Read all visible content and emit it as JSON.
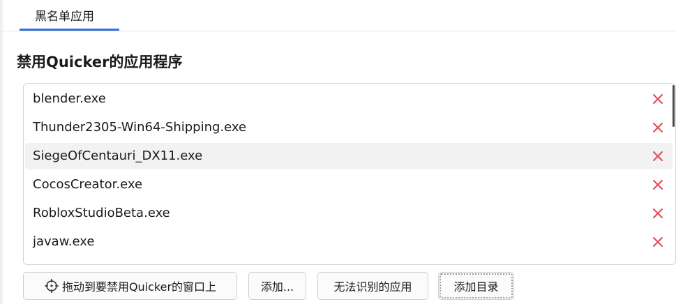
{
  "tabs": [
    {
      "label": "黑名单应用",
      "active": true
    }
  ],
  "page_title": "禁用Quicker的应用程序",
  "apps": [
    {
      "name": "blender.exe"
    },
    {
      "name": "Thunder2305-Win64-Shipping.exe"
    },
    {
      "name": "SiegeOfCentauri_DX11.exe",
      "hovered": true
    },
    {
      "name": "CocosCreator.exe"
    },
    {
      "name": "RobloxStudioBeta.exe"
    },
    {
      "name": "javaw.exe"
    }
  ],
  "row_action_icon": "close-icon",
  "buttons": {
    "drag_to_window": "拖动到要禁用Quicker的窗口上",
    "add": "添加...",
    "unrecognized_apps": "无法识别的应用",
    "add_directory": "添加目录"
  },
  "colors": {
    "accent": "#2f6fe0",
    "remove_icon": "#e5484d",
    "hover_row": "#f2f2f2"
  }
}
